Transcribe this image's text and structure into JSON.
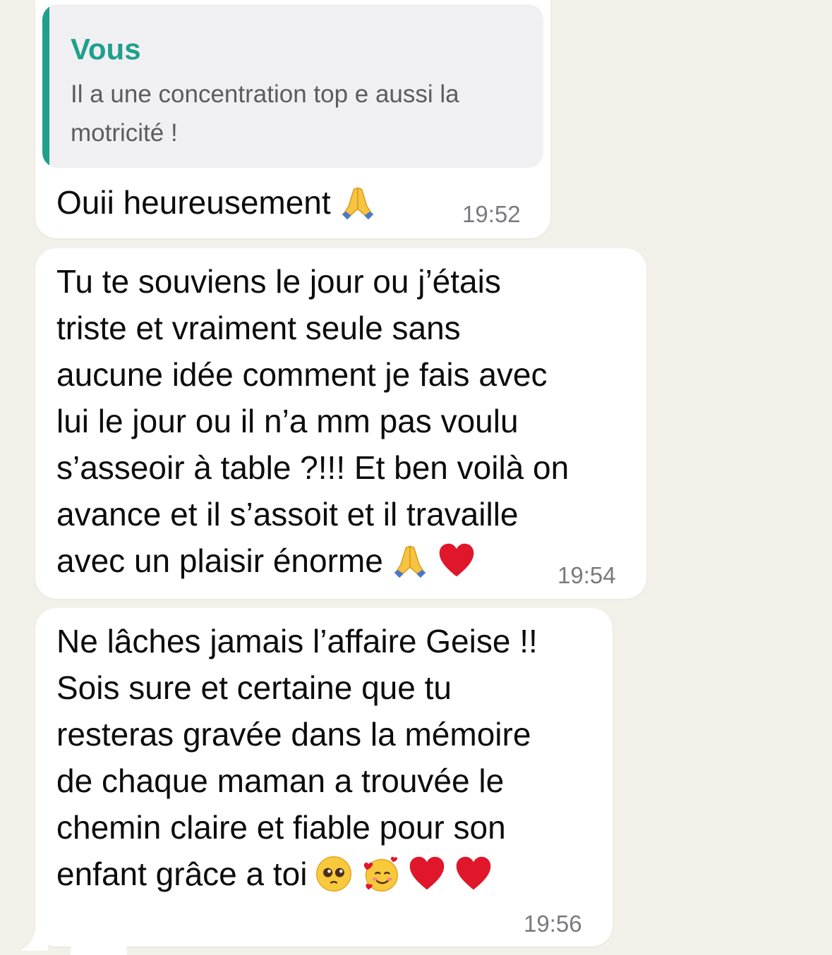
{
  "chat": {
    "background_color": "#f3efe9",
    "accent_color": "#1f9f8c",
    "messages": [
      {
        "reply": {
          "author": "Vous",
          "text": "Il a une concentration top e aussi la\nmotricité !"
        },
        "text": "Ouii heureusement",
        "emojis": [
          "folded-hands"
        ],
        "time": "19:52"
      },
      {
        "text": "Tu te souviens le jour ou j’étais\ntriste et vraiment seule sans\naucune idée comment je fais avec\nlui le jour ou il n’a mm pas voulu\ns’asseoir à table ?!!! Et ben voilà on\navance et il s’assoit et il travaille\navec un plaisir énorme",
        "emojis": [
          "folded-hands",
          "red-heart"
        ],
        "time": "19:54"
      },
      {
        "text": "Ne lâches jamais l’affaire Geise !!\nSois sure et certaine que tu\nresteras gravée dans la mémoire\nde chaque maman a trouvée le\nchemin claire et fiable pour son\nenfant grâce a toi",
        "emojis": [
          "pleading-face",
          "smiling-face-with-hearts",
          "red-heart",
          "red-heart"
        ],
        "time": "19:56"
      }
    ]
  }
}
